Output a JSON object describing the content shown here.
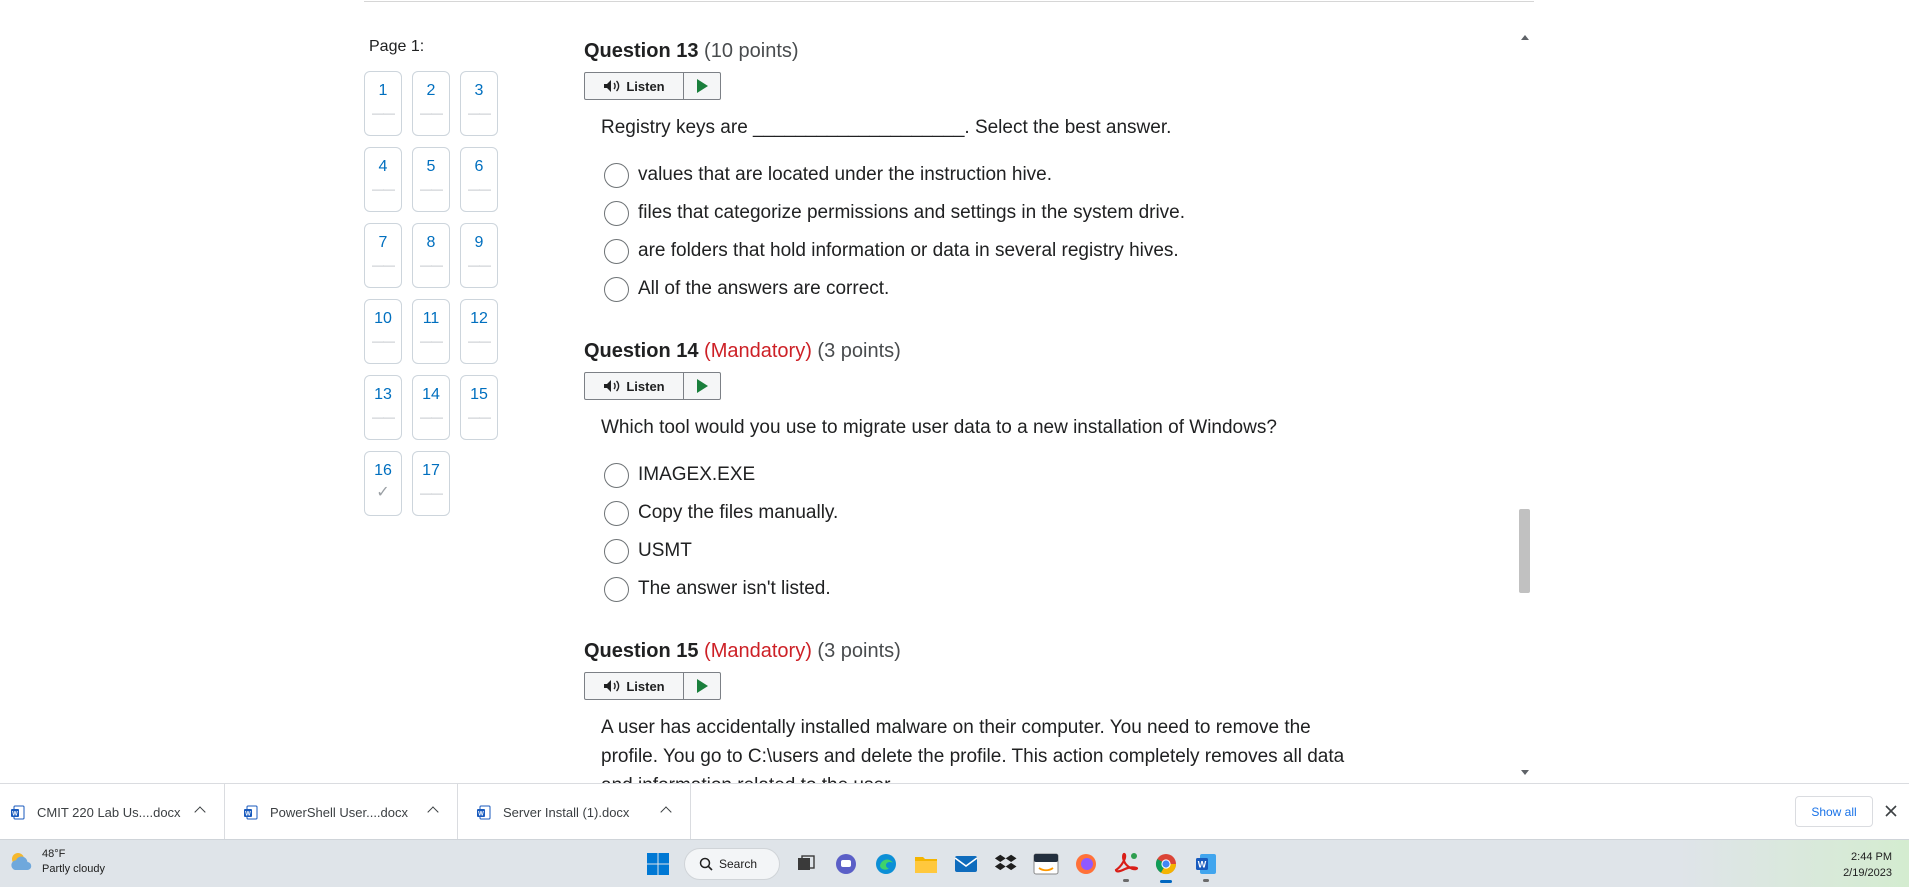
{
  "navigator": {
    "title": "Page 1:",
    "pages": [
      {
        "num": "1",
        "mark": "——"
      },
      {
        "num": "2",
        "mark": "——"
      },
      {
        "num": "3",
        "mark": "——"
      },
      {
        "num": "4",
        "mark": "——"
      },
      {
        "num": "5",
        "mark": "——"
      },
      {
        "num": "6",
        "mark": "——"
      },
      {
        "num": "7",
        "mark": "——"
      },
      {
        "num": "8",
        "mark": "——"
      },
      {
        "num": "9",
        "mark": "——"
      },
      {
        "num": "10",
        "mark": "——"
      },
      {
        "num": "11",
        "mark": "——"
      },
      {
        "num": "12",
        "mark": "——"
      },
      {
        "num": "13",
        "mark": "——"
      },
      {
        "num": "14",
        "mark": "——"
      },
      {
        "num": "15",
        "mark": "——"
      },
      {
        "num": "16",
        "mark": "✓"
      },
      {
        "num": "17",
        "mark": "——"
      }
    ]
  },
  "listen_label": "Listen",
  "questions": [
    {
      "number": "Question 13",
      "mandatory": "",
      "points": "(10 points)",
      "text": "Registry keys are ____________________. Select the best answer.",
      "options": [
        "values that are located under the instruction hive.",
        "files that categorize permissions and settings in the system drive.",
        "are folders that hold information or data in several registry hives.",
        "All of the answers are correct."
      ]
    },
    {
      "number": "Question 14",
      "mandatory": "(Mandatory)",
      "points": "(3 points)",
      "text": "Which tool would you use to migrate user data to a new installation of Windows?",
      "options": [
        "IMAGEX.EXE",
        "Copy the files manually.",
        "USMT",
        "The answer isn't listed."
      ]
    },
    {
      "number": "Question 15",
      "mandatory": "(Mandatory)",
      "points": "(3 points)",
      "text": "A user has accidentally installed malware on their computer. You need to remove the profile. You go to C:\\users and delete the profile. This action completely removes all data and information related to the user.",
      "options": []
    }
  ],
  "downloads": {
    "items": [
      {
        "name": "CMIT 220 Lab Us....docx"
      },
      {
        "name": "PowerShell User....docx"
      },
      {
        "name": "Server Install (1).docx"
      }
    ],
    "show_all": "Show all"
  },
  "taskbar": {
    "weather_temp": "48°F",
    "weather_desc": "Partly cloudy",
    "search_label": "Search",
    "time": "2:44 PM",
    "date": "2/19/2023"
  },
  "colors": {
    "link_blue": "#006fbf",
    "mandatory_red": "#cd2026",
    "play_green": "#1a7f3c",
    "word_blue": "#185abd"
  }
}
